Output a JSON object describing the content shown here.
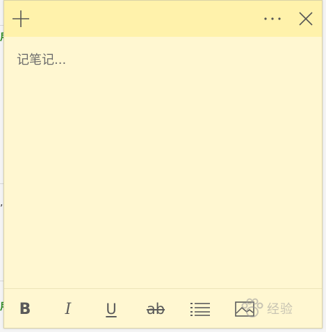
{
  "background_app": {
    "glyph_1": "用",
    "glyph_2": ",",
    "glyph_3": "用"
  },
  "note": {
    "placeholder": "记笔记...",
    "background_color": "#fff7d1",
    "titlebar_color": "#fff2ab"
  },
  "titlebar": {
    "add_icon": "plus-icon",
    "more_icon": "ellipsis-icon",
    "close_icon": "close-icon"
  },
  "toolbar": {
    "bold_label": "B",
    "italic_label": "I",
    "underline_label": "U",
    "strikethrough_label": "ab",
    "list_icon": "bullet-list-icon",
    "image_icon": "image-icon"
  },
  "watermark": {
    "text": "经验"
  }
}
